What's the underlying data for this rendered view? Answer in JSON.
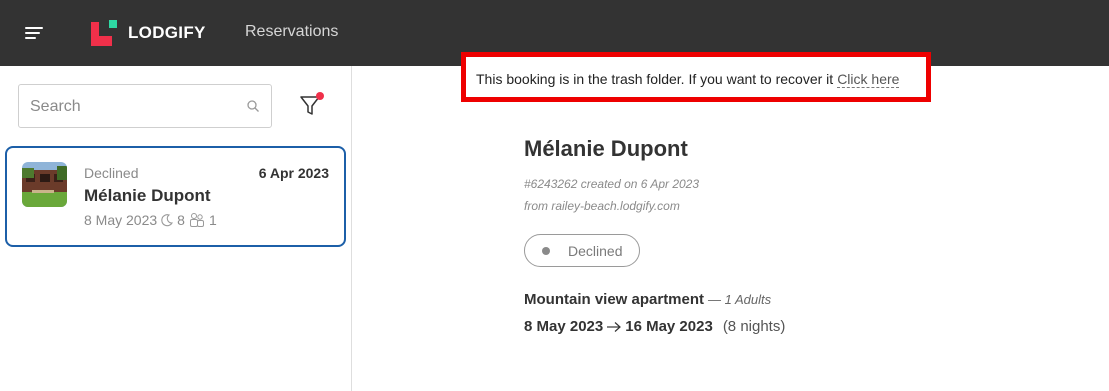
{
  "app": {
    "brand": "LODGIFY",
    "nav_label": "Reservations",
    "colors": {
      "topbar": "#333333",
      "logo_red": "#f0304a",
      "logo_green": "#2ed8a3",
      "selected_border": "#1c5fa8",
      "banner_border": "#ee0000"
    }
  },
  "sidebar": {
    "search": {
      "placeholder": "Search",
      "value": ""
    },
    "filter_icon": "filter-icon",
    "bookings": [
      {
        "status": "Declined",
        "created_date": "6 Apr 2023",
        "guest_name": "Mélanie Dupont",
        "checkin": "8 May 2023",
        "nights": "8",
        "guests": "1"
      }
    ]
  },
  "detail": {
    "trash_notice": "This booking is in the trash folder. If you want to recover it",
    "recover_link": "Click here",
    "guest_name": "Mélanie Dupont",
    "booking_ref": "#6243262 created on 6 Apr 2023",
    "source": "from railey-beach.lodgify.com",
    "status": "Declined",
    "property": "Mountain view apartment",
    "guests_note": "— 1 Adults",
    "checkin": "8 May 2023",
    "checkout": "16 May 2023",
    "nights_label": "(8 nights)"
  }
}
